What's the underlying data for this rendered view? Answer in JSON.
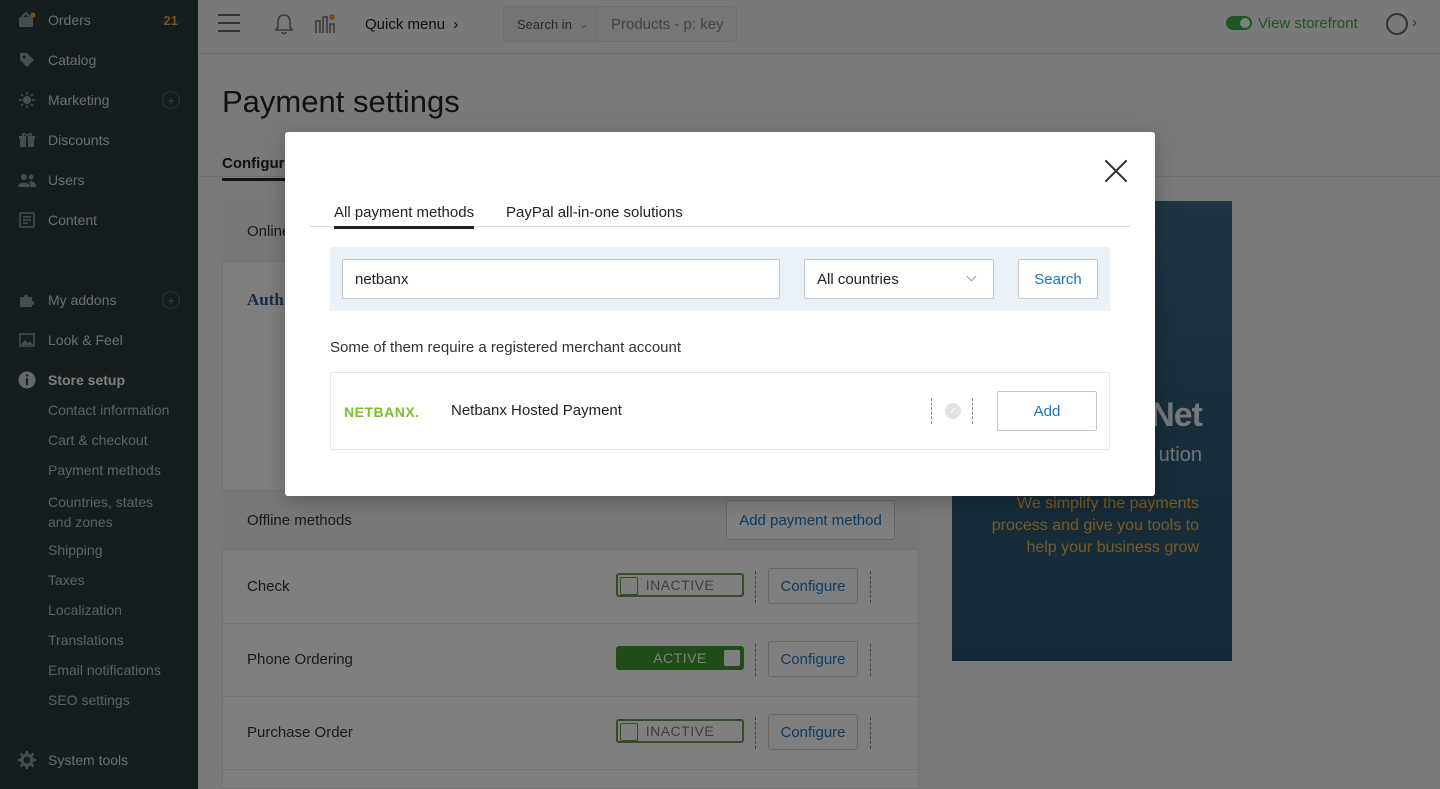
{
  "sidebar": {
    "items": [
      {
        "label": "Orders",
        "count": "21",
        "icon": "orders-icon"
      },
      {
        "label": "Catalog",
        "icon": "tag-icon"
      },
      {
        "label": "Marketing",
        "icon": "marketing-icon",
        "plus": "+"
      },
      {
        "label": "Discounts",
        "icon": "gift-icon"
      },
      {
        "label": "Users",
        "icon": "users-icon"
      },
      {
        "label": "Content",
        "icon": "content-icon"
      },
      {
        "label": "My addons",
        "icon": "puzzle-icon",
        "plus": "+"
      },
      {
        "label": "Look & Feel",
        "icon": "image-icon"
      },
      {
        "label": "Store setup",
        "icon": "info-icon"
      }
    ],
    "store_setup_sub": [
      "Contact information",
      "Cart & checkout",
      "Payment methods",
      "Countries, states and zones",
      "Shipping",
      "Taxes",
      "Localization",
      "Translations",
      "Email notifications",
      "SEO settings"
    ],
    "system_tools": "System tools"
  },
  "header": {
    "quick_menu": "Quick menu",
    "quick_menu_chevron": "›",
    "search_in": "Search in",
    "search_in_chevron": "⌄",
    "search_value": "Products - p: key",
    "view_storefront": "View storefront",
    "user_chevron": "›"
  },
  "page": {
    "title": "Payment settings",
    "tab": "Configura",
    "online_label": "Online",
    "auth_logo": "Auth",
    "offline_label": "Offline methods",
    "add_payment_method": "Add payment method",
    "methods": [
      {
        "name": "Check",
        "status": "INACTIVE",
        "configure": "Configure"
      },
      {
        "name": "Phone Ordering",
        "status": "ACTIVE",
        "configure": "Configure"
      },
      {
        "name": "Purchase Order",
        "status": "INACTIVE",
        "configure": "Configure"
      }
    ],
    "banner": {
      "brand": "Net",
      "subtitle": "ution",
      "text": "We simplify the payments process and give you tools to help your business grow"
    }
  },
  "modal": {
    "tabs": [
      "All payment methods",
      "PayPal all-in-one solutions"
    ],
    "search_value": "netbanx",
    "country_select": "All countries",
    "search_button": "Search",
    "note": "Some of them require a registered merchant account",
    "result": {
      "logo_text": "NETBANX",
      "logo_dot": ".",
      "name": "Netbanx Hosted Payment",
      "add_button": "Add"
    }
  },
  "colors": {
    "sidebar_bg": "#2d3b3d",
    "accent_blue": "#1a76c2",
    "active_green": "#3e9a2c",
    "storefront_green": "#3fae49",
    "orders_count": "#f0a030"
  }
}
